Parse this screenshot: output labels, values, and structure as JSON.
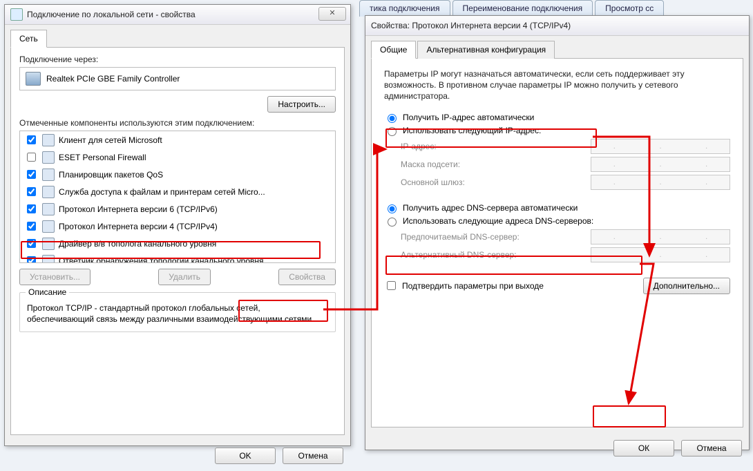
{
  "topmenu": {
    "a": "тика подключения",
    "b": "Переименование подключения",
    "c": "Просмотр сс"
  },
  "left": {
    "title": "Подключение по локальной сети - свойства",
    "closeGlyph": "✕",
    "tab": "Сеть",
    "connectVia": "Подключение через:",
    "adapter": "Realtek PCIe GBE Family Controller",
    "configure": "Настроить...",
    "componentsLabel": "Отмеченные компоненты используются этим подключением:",
    "items": [
      {
        "checked": true,
        "label": "Клиент для сетей Microsoft"
      },
      {
        "checked": false,
        "label": "ESET Personal Firewall"
      },
      {
        "checked": true,
        "label": "Планировщик пакетов QoS"
      },
      {
        "checked": true,
        "label": "Служба доступа к файлам и принтерам сетей Micro..."
      },
      {
        "checked": true,
        "label": "Протокол Интернета версии 6 (TCP/IPv6)"
      },
      {
        "checked": true,
        "label": "Протокол Интернета версии 4 (TCP/IPv4)"
      },
      {
        "checked": true,
        "label": "Драйвер в/в тополога канального уровня"
      },
      {
        "checked": true,
        "label": "Ответчик обнаружения топологии канального уровня"
      }
    ],
    "install": "Установить...",
    "remove": "Удалить",
    "props": "Свойства",
    "descTitle": "Описание",
    "desc": "Протокол TCP/IP - стандартный протокол глобальных сетей, обеспечивающий связь между различными взаимодействующими сетями.",
    "ok": "OK",
    "cancel": "Отмена"
  },
  "right": {
    "title": "Свойства: Протокол Интернета версии 4 (TCP/IPv4)",
    "tab1": "Общие",
    "tab2": "Альтернативная конфигурация",
    "info": "Параметры IP могут назначаться автоматически, если сеть поддерживает эту возможность. В противном случае параметры IP можно получить у сетевого администратора.",
    "r1": "Получить IP-адрес автоматически",
    "r2": "Использовать следующий IP-адрес:",
    "ip": "IP-адрес:",
    "mask": "Маска подсети:",
    "gw": "Основной шлюз:",
    "r3": "Получить адрес DNS-сервера автоматически",
    "r4": "Использовать следующие адреса DNS-серверов:",
    "dns1": "Предпочитаемый DNS-сервер:",
    "dns2": "Альтернативный DNS-сервер:",
    "validate": "Подтвердить параметры при выходе",
    "advanced": "Дополнительно...",
    "ok": "ОК",
    "cancel": "Отмена"
  }
}
